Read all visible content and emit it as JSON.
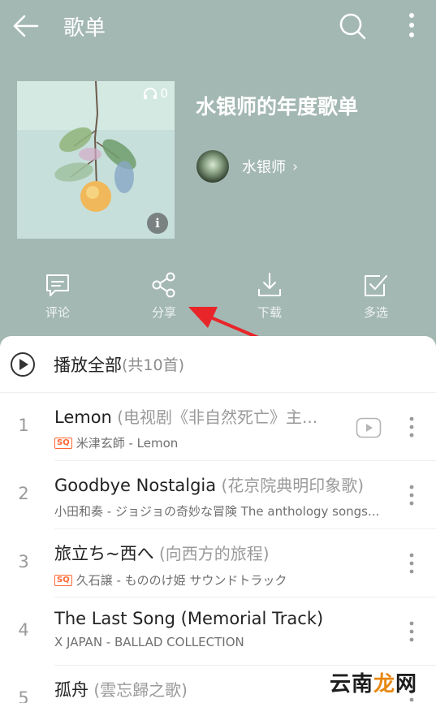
{
  "topbar": {
    "title": "歌单",
    "back_icon": "arrow-left-icon",
    "search_icon": "search-icon",
    "more_icon": "more-vertical-icon"
  },
  "playlist": {
    "title": "水银师的年度歌单",
    "play_count": "0",
    "creator_name": "水银师",
    "creator_chevron": "›"
  },
  "actions": [
    {
      "label": "评论",
      "icon": "comment-icon"
    },
    {
      "label": "分享",
      "icon": "share-icon"
    },
    {
      "label": "下载",
      "icon": "download-icon"
    },
    {
      "label": "多选",
      "icon": "multi-select-icon"
    }
  ],
  "play_all": {
    "label": "播放全部",
    "count": "(共10首)"
  },
  "songs": [
    {
      "index": "1",
      "title": "Lemon",
      "subtitle": " (电视剧《非自然死亡》主...",
      "sq": "SQ",
      "info": "米津玄師 - Lemon",
      "has_video": true
    },
    {
      "index": "2",
      "title": "Goodbye Nostalgia",
      "subtitle": " (花京院典明印象歌)",
      "sq": "",
      "info": "小田和奏 - ジョジョの奇妙な冒険 The anthology songs...",
      "has_video": false
    },
    {
      "index": "3",
      "title": "旅立ち~西へ",
      "subtitle": " (向西方的旅程)",
      "sq": "SQ",
      "info": "久石譲 - もののけ姫 サウンドトラック",
      "has_video": false
    },
    {
      "index": "4",
      "title": "The Last Song (Memorial Track)",
      "subtitle": "",
      "sq": "",
      "info": "X JAPAN - BALLAD COLLECTION",
      "has_video": false
    },
    {
      "index": "5",
      "title": "孤舟",
      "subtitle": " (雲忘歸之歌)",
      "sq": "",
      "info": "",
      "has_video": false
    }
  ],
  "watermark": {
    "part1": "云南",
    "part2": "龙",
    "part3": "网"
  },
  "colors": {
    "header_bg": "#a4b8b3",
    "annotation_arrow": "#e8262a",
    "sq_badge": "#ff6633"
  }
}
